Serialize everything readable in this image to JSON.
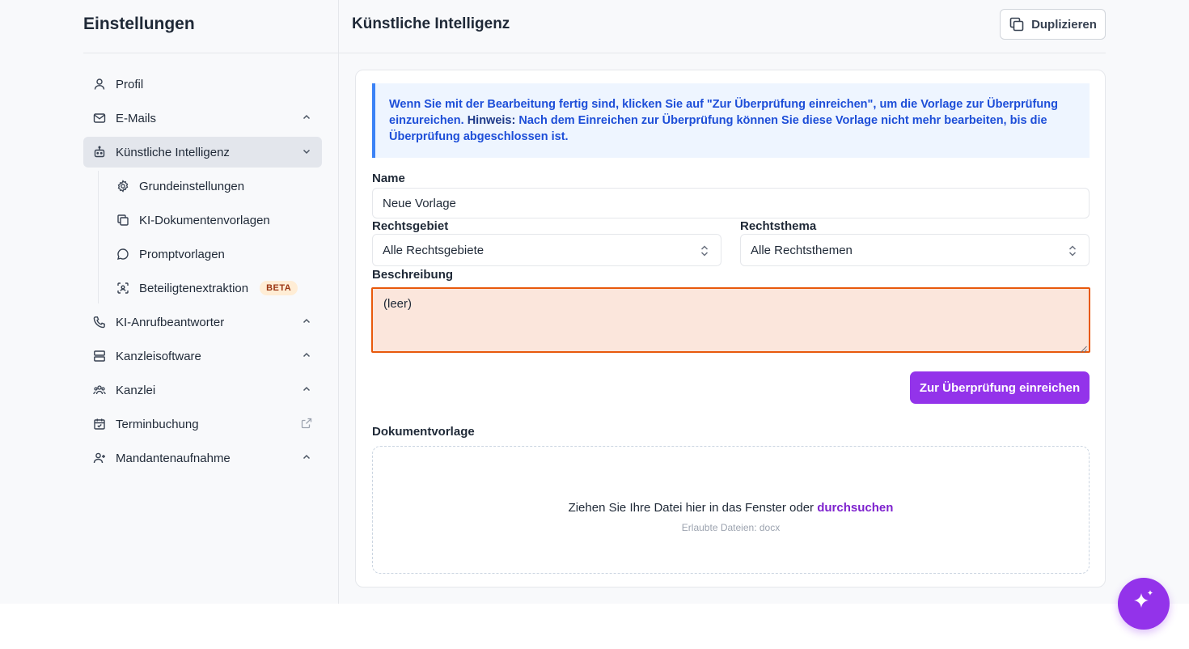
{
  "sidebar": {
    "title": "Einstellungen",
    "items": [
      {
        "label": "Profil",
        "icon": "user-icon"
      },
      {
        "label": "E-Mails",
        "icon": "mail-icon"
      },
      {
        "label": "Künstliche Intelligenz",
        "icon": "robot-icon"
      },
      {
        "label": "KI-Anrufbeantworter",
        "icon": "phone-icon"
      },
      {
        "label": "Kanzleisoftware",
        "icon": "server-icon"
      },
      {
        "label": "Kanzlei",
        "icon": "users-icon"
      },
      {
        "label": "Terminbuchung",
        "icon": "calendar-icon"
      },
      {
        "label": "Mandantenaufnahme",
        "icon": "user-plus-icon"
      }
    ],
    "sub_items": [
      {
        "label": "Grundeinstellungen",
        "icon": "gear-icon"
      },
      {
        "label": "KI-Dokumentenvorlagen",
        "icon": "copy-icon"
      },
      {
        "label": "Promptvorlagen",
        "icon": "chat-bubble-icon"
      },
      {
        "label": "Beteiligtenextraktion",
        "icon": "scan-icon",
        "badge": "BETA"
      }
    ]
  },
  "header": {
    "title": "Künstliche Intelligenz",
    "duplicate_label": "Duplizieren"
  },
  "notice": {
    "text_before": "Wenn Sie mit der Bearbeitung fertig sind, klicken Sie auf \"Zur Überprüfung einreichen\", um die Vorlage zur Überprüfung einzureichen. ",
    "bold": "Hinweis:",
    "text_after": " Nach dem Einreichen zur Überprüfung können Sie diese Vorlage nicht mehr bearbeiten, bis die Überprüfung abgeschlossen ist."
  },
  "form": {
    "name_label": "Name",
    "name_value": "Neue Vorlage",
    "rechtsgebiet_label": "Rechtsgebiet",
    "rechtsgebiet_value": "Alle Rechtsgebiete",
    "rechtsthema_label": "Rechtsthema",
    "rechtsthema_value": "Alle Rechtsthemen",
    "beschreibung_label": "Beschreibung",
    "beschreibung_value": "(leer)",
    "submit_label": "Zur Überprüfung einreichen",
    "dokument_label": "Dokumentvorlage",
    "dropzone_text": "Ziehen Sie Ihre Datei hier in das Fenster oder",
    "dropzone_link": "durchsuchen",
    "dropzone_hint": "Erlaubte Dateien: docx"
  },
  "colors": {
    "accent": "#9333ea",
    "notice_bg": "#eef5ff",
    "notice_border": "#3b82f6",
    "error_border": "#e8590c",
    "error_bg": "#fbe6dc"
  }
}
